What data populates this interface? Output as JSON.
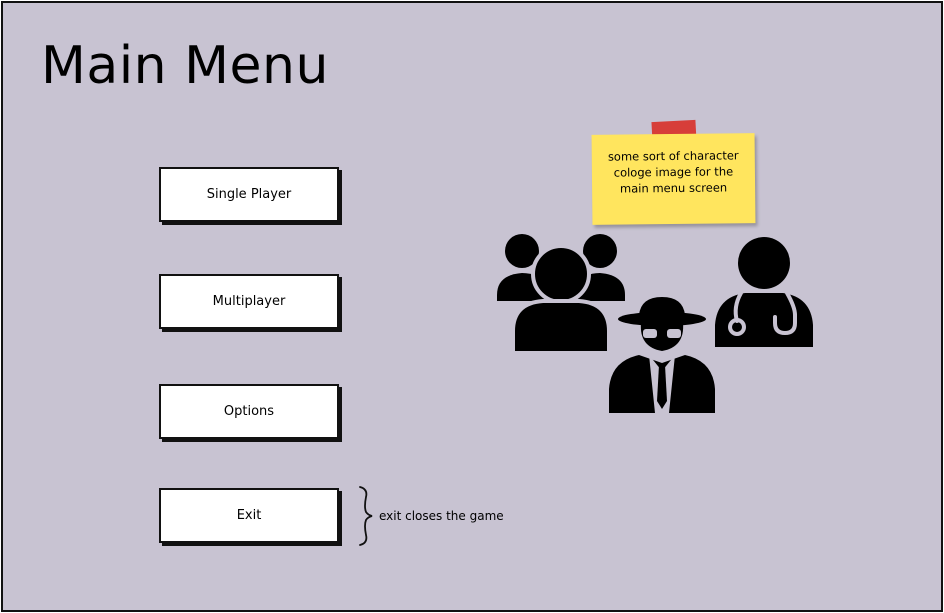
{
  "header": {
    "title": "Main Menu"
  },
  "menu": {
    "single_player": "Single Player",
    "multiplayer": "Multiplayer",
    "options": "Options",
    "exit": "Exit"
  },
  "annotation": {
    "exit_note": "exit closes the game"
  },
  "sticky_note": {
    "text": "some sort of character cologe image for the main menu screen"
  },
  "icons": [
    "group-icon",
    "spy-icon",
    "doctor-icon"
  ],
  "colors": {
    "background": "#c8c3d2",
    "sticky": "#ffe55e",
    "tape": "#d8332b"
  }
}
